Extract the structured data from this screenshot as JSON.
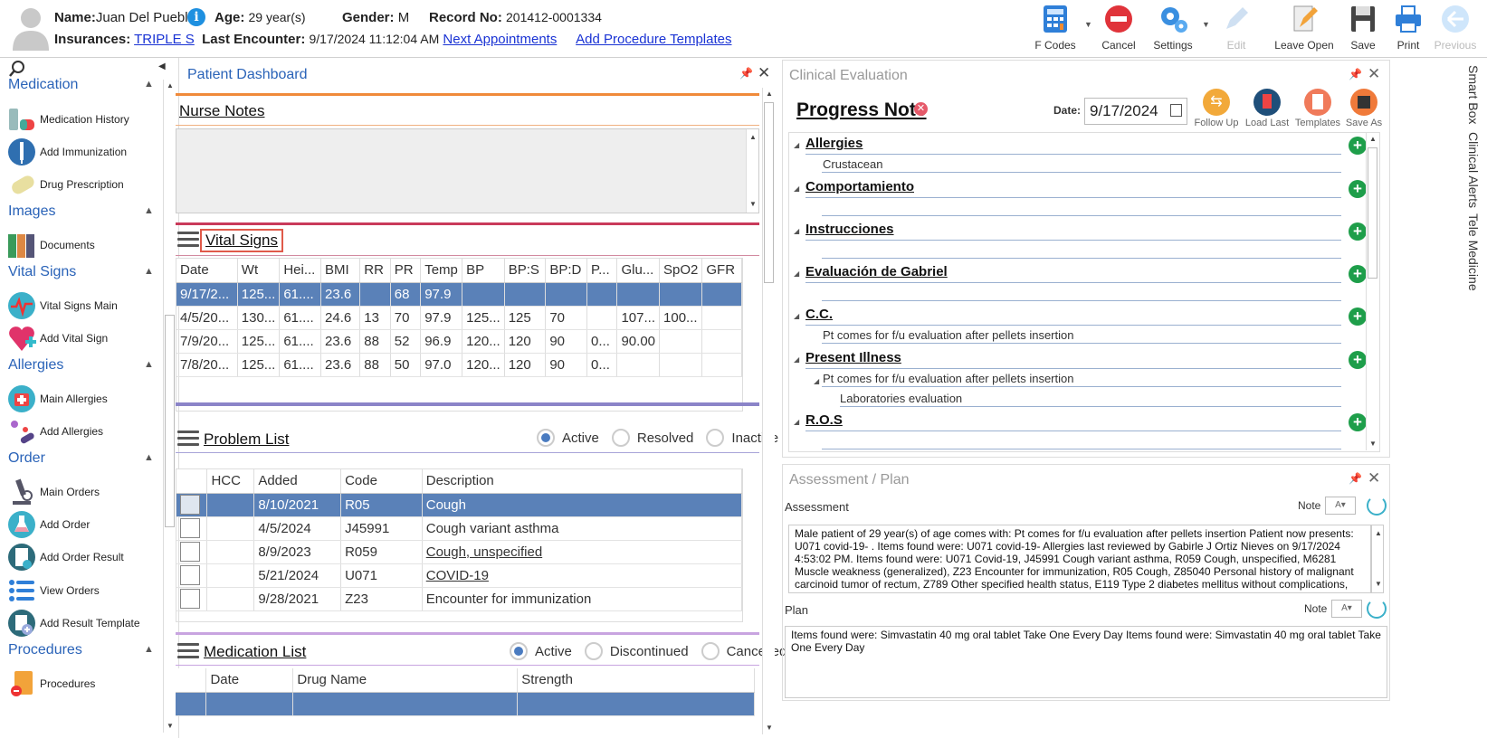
{
  "header": {
    "name_label": "Name:",
    "name": "Juan Del Pueblo",
    "age_label": "Age:",
    "age": "29 year(s)",
    "gender_label": "Gender:",
    "gender": "M",
    "record_label": "Record No:",
    "record": "201412-0001334",
    "insurances_label": "Insurances:",
    "insurance": "TRIPLE S",
    "last_enc_label": "Last Encounter:",
    "last_enc": "9/17/2024 11:12:04 AM",
    "next_appts": "Next Appointments",
    "add_proc_templates": "Add Procedure Templates"
  },
  "toolbar": {
    "fcodes": "F Codes",
    "cancel": "Cancel",
    "settings": "Settings",
    "edit": "Edit",
    "leave_open": "Leave Open",
    "save": "Save",
    "print": "Print",
    "previous": "Previous"
  },
  "sidebar": {
    "medication": "Medication",
    "med_history": "Medication History",
    "add_immunization": "Add Immunization",
    "drug_prescription": "Drug Prescription",
    "images": "Images",
    "documents": "Documents",
    "vital_signs": "Vital Signs",
    "vital_main": "Vital Signs Main",
    "add_vital": "Add Vital Sign",
    "allergies": "Allergies",
    "main_allergies": "Main Allergies",
    "add_allergies": "Add Allergies",
    "order": "Order",
    "main_orders": "Main Orders",
    "add_order": "Add Order",
    "add_order_result": "Add Order Result",
    "view_orders": "View Orders",
    "add_result_template": "Add Result Template",
    "procedures": "Procedures",
    "procedures_item": "Procedures"
  },
  "dashboard": {
    "title": "Patient Dashboard",
    "nurse_notes": "Nurse Notes",
    "vital_signs": "Vital Signs",
    "vitals_cols": [
      "Date",
      "Wt",
      "Hei...",
      "BMI",
      "RR",
      "PR",
      "Temp",
      "BP",
      "BP:S",
      "BP:D",
      "P...",
      "Glu...",
      "SpO2",
      "GFR"
    ],
    "vitals_rows": [
      [
        "9/17/2...",
        "125...",
        "61....",
        "23.6",
        "",
        "68",
        "97.9",
        "",
        "",
        "",
        "",
        "",
        "",
        ""
      ],
      [
        "4/5/20...",
        "130...",
        "61....",
        "24.6",
        "13",
        "70",
        "97.9",
        "125...",
        "125",
        "70",
        "",
        "107...",
        "100...",
        ""
      ],
      [
        "7/9/20...",
        "125...",
        "61....",
        "23.6",
        "88",
        "52",
        "96.9",
        "120...",
        "120",
        "90",
        "0...",
        "90.00",
        "",
        ""
      ],
      [
        "7/8/20...",
        "125...",
        "61....",
        "23.6",
        "88",
        "50",
        "97.0",
        "120...",
        "120",
        "90",
        "0...",
        "",
        "",
        ""
      ]
    ],
    "problem_list": "Problem List",
    "pl_active": "Active",
    "pl_resolved": "Resolved",
    "pl_inactive": "Inactive",
    "pl_cols": [
      "",
      "HCC",
      "Added",
      "Code",
      "Description"
    ],
    "pl_rows": [
      [
        "",
        "",
        "8/10/2021",
        "R05",
        "Cough"
      ],
      [
        "",
        "",
        "4/5/2024",
        "J45991",
        "Cough variant asthma"
      ],
      [
        "",
        "",
        "8/9/2023",
        "R059",
        "Cough, unspecified"
      ],
      [
        "",
        "",
        "5/21/2024",
        "U071",
        "COVID-19"
      ],
      [
        "",
        "",
        "9/28/2021",
        "Z23",
        "Encounter for immunization"
      ]
    ],
    "medication_list": "Medication List",
    "ml_active": "Active",
    "ml_discontinued": "Discontinued",
    "ml_cancelled": "Cancelled",
    "ml_cols": [
      "",
      "Date",
      "Drug Name",
      "Strength"
    ]
  },
  "clinical": {
    "title": "Clinical Evaluation",
    "note_title": "Progress Note",
    "date_label": "Date:",
    "date": "9/17/2024",
    "follow_up": "Follow Up",
    "load_last": "Load Last",
    "templates": "Templates",
    "save_as": "Save As",
    "allergies": "Allergies",
    "crustacean": "Crustacean",
    "comportamiento": "Comportamiento",
    "instrucciones": "Instrucciones",
    "evaluacion": "Evaluación de Gabriel",
    "cc": "C.C.",
    "cc_text": "Pt comes for f/u evaluation after pellets insertion",
    "present_illness": "Present Illness",
    "pi_text": "Pt comes for f/u evaluation after pellets insertion",
    "pi_sub": "Laboratories evaluation",
    "ros": "R.O.S"
  },
  "assessment": {
    "title": "Assessment / Plan",
    "assessment_label": "Assessment",
    "note_label": "Note",
    "plan_label": "Plan",
    "assessment_text": "Male patient of 29 year(s) of age comes with:  Pt comes for f/u evaluation after pellets insertion  Patient now presents: U071 covid-19- . Items found were:  U071 covid-19-    Allergies last reviewed by Gabirle J Ortiz Nieves on 9/17/2024 4:53:02 PM.     Items found were:  U071 Covid-19, J45991 Cough variant asthma, R059 Cough, unspecified, M6281 Muscle weakness (generalized), Z23 Encounter for immunization, R05 Cough, Z85040 Personal history of malignant carcinoid tumor of rectum, Z789 Other specified health status, E119 Type 2 diabetes mellitus without complications,",
    "plan_text": "  Items found were:  Simvastatin 40 mg oral tablet Take One Every Day   Items found were:  Simvastatin 40 mg oral tablet Take One Every Day"
  },
  "right_tabs": {
    "smart_box": "Smart Box",
    "clinical_alerts": "Clinical Alerts",
    "tele_medicine": "Tele Medicine"
  }
}
